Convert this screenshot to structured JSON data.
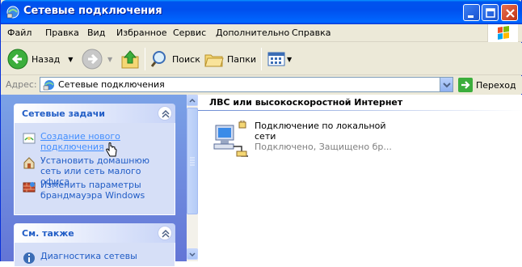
{
  "window": {
    "title": "Сетевые подключения"
  },
  "menu": [
    "Файл",
    "Правка",
    "Вид",
    "Избранное",
    "Сервис",
    "Дополнительно",
    "Справка"
  ],
  "toolbar": {
    "back_label": "Назад",
    "search_label": "Поиск",
    "folders_label": "Папки"
  },
  "address": {
    "label": "Адрес:",
    "value": "Сетевые подключения",
    "go_label": "Переход"
  },
  "network_tasks": {
    "title": "Сетевые задачи",
    "items": [
      "Создание нового подключения",
      "Установить домашнюю сеть или сеть малого офиса",
      "Изменить параметры брандмауэра Windows"
    ]
  },
  "see_also": {
    "title": "См. также",
    "items": [
      "Диагностика сетевы"
    ]
  },
  "content": {
    "group_title": "ЛВС или высокоскоростной Интернет",
    "connection": {
      "name": "Подключение по локальной сети",
      "status": "Подключено, Защищено бр..."
    }
  },
  "colors": {
    "titlebar": "#0053ee",
    "task_link": "#215dc6",
    "pane_bg": "#7ba2e7"
  }
}
